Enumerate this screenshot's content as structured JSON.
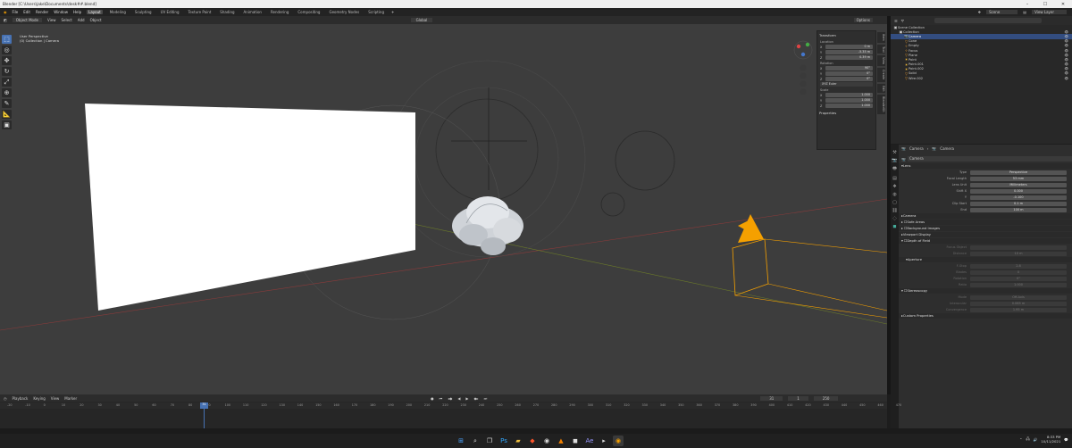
{
  "window": {
    "title": "Blender [C:\\Users\\jake\\Documents\\desk##.blend]"
  },
  "topbar": {
    "menus": [
      "File",
      "Edit",
      "Render",
      "Window",
      "Help"
    ],
    "workspaces": [
      "Layout",
      "Modeling",
      "Sculpting",
      "UV Editing",
      "Texture Paint",
      "Shading",
      "Animation",
      "Rendering",
      "Compositing",
      "Geometry Nodes",
      "Scripting"
    ],
    "scene": "Scene",
    "view_layer": "View Layer"
  },
  "viewport": {
    "mode": "Object Mode",
    "menus": [
      "View",
      "Select",
      "Add",
      "Object"
    ],
    "transform_orientation": "Global",
    "options_label": "Options",
    "info_line1": "User Perspective",
    "info_line2": "(0) Collection | Camera"
  },
  "npanel": {
    "tab_labels": [
      "Item",
      "Tool",
      "View",
      "Create",
      "Edit",
      "BlenderKit"
    ],
    "transform_header": "Transform",
    "location_label": "Location",
    "location": [
      {
        "axis": "X",
        "value": "0 m"
      },
      {
        "axis": "Y",
        "value": "-5.35 m"
      },
      {
        "axis": "Z",
        "value": "0.39 m"
      }
    ],
    "rotation_label": "Rotation",
    "rotation": [
      {
        "axis": "X",
        "value": "90°"
      },
      {
        "axis": "Y",
        "value": "0°"
      },
      {
        "axis": "Z",
        "value": "0°"
      }
    ],
    "rotation_mode": "XYZ Euler",
    "scale_label": "Scale",
    "scale": [
      {
        "axis": "X",
        "value": "1.000"
      },
      {
        "axis": "Y",
        "value": "1.000"
      },
      {
        "axis": "Z",
        "value": "1.000"
      }
    ],
    "properties_header": "Properties"
  },
  "outliner": {
    "search_placeholder": "",
    "root": "Scene Collection",
    "items": [
      {
        "name": "Collection",
        "icon": "collection-icon",
        "indent": 1,
        "selected": false
      },
      {
        "name": "Camera",
        "icon": "camera-icon",
        "indent": 2,
        "selected": true
      },
      {
        "name": "Cone",
        "icon": "mesh-icon",
        "indent": 2,
        "selected": false
      },
      {
        "name": "Empty",
        "icon": "empty-icon",
        "indent": 2,
        "selected": false
      },
      {
        "name": "Focus",
        "icon": "empty-icon",
        "indent": 2,
        "selected": false
      },
      {
        "name": "Plane",
        "icon": "mesh-icon",
        "indent": 2,
        "selected": false
      },
      {
        "name": "Point",
        "icon": "light-icon",
        "indent": 2,
        "selected": false
      },
      {
        "name": "Point.001",
        "icon": "light-icon",
        "indent": 2,
        "selected": false
      },
      {
        "name": "Point.002",
        "icon": "light-icon",
        "indent": 2,
        "selected": false
      },
      {
        "name": "Solid",
        "icon": "mesh-icon",
        "indent": 2,
        "selected": false
      },
      {
        "name": "Wire.002",
        "icon": "mesh-icon",
        "indent": 2,
        "selected": false
      }
    ]
  },
  "properties": {
    "breadcrumb_object": "Camera",
    "breadcrumb_data": "Camera",
    "datablock": "Camera",
    "sections": {
      "lens": "Lens",
      "camera": "Camera",
      "safe_areas": "Safe Areas",
      "background_images": "Background Images",
      "viewport_display": "Viewport Display",
      "depth_of_field": "Depth of Field",
      "aperture": "Aperture",
      "stereoscopy": "Stereoscopy",
      "custom_properties": "Custom Properties"
    },
    "lens": [
      {
        "label": "Type",
        "value": "Perspective"
      },
      {
        "label": "Focal Length",
        "value": "53 mm"
      },
      {
        "label": "Lens Unit",
        "value": "Millimeters"
      },
      {
        "label": "Shift X",
        "value": "0.000"
      },
      {
        "label": "Y",
        "value": "-0.100"
      },
      {
        "label": "Clip Start",
        "value": "0.1 m"
      },
      {
        "label": "End",
        "value": "100 m"
      }
    ],
    "dof": [
      {
        "label": "Focus Object",
        "value": ""
      },
      {
        "label": "Distance",
        "value": "10 m"
      }
    ],
    "aperture": [
      {
        "label": "F-Stop",
        "value": "2.8"
      },
      {
        "label": "Blades",
        "value": "0"
      },
      {
        "label": "Rotation",
        "value": "0°"
      },
      {
        "label": "Ratio",
        "value": "1.000"
      }
    ],
    "stereo": [
      {
        "label": "Mode",
        "value": "Off-Axis"
      },
      {
        "label": "Interocular",
        "value": "0.065 m"
      },
      {
        "label": "Convergence",
        "value": "1.95 m"
      }
    ]
  },
  "timeline": {
    "menus": [
      "Playback",
      "Keying",
      "View",
      "Marker"
    ],
    "current_frame": "31",
    "start": "1",
    "end": "250",
    "ruler": [
      "-20",
      "-10",
      "0",
      "10",
      "20",
      "30",
      "40",
      "50",
      "60",
      "70",
      "80",
      "90",
      "100",
      "110",
      "120",
      "130",
      "140",
      "150",
      "160",
      "170",
      "180",
      "190",
      "200",
      "210",
      "220",
      "230",
      "240",
      "250",
      "260",
      "270",
      "280",
      "290",
      "300",
      "310",
      "320",
      "330",
      "340",
      "350",
      "360",
      "370",
      "380",
      "390",
      "400",
      "410",
      "420",
      "430",
      "440",
      "450",
      "460",
      "470"
    ]
  },
  "taskbar": {
    "time": "8:33 PM",
    "date": "10/11/2021"
  },
  "colors": {
    "accent": "#4772b3",
    "selection": "#334d80",
    "camera_orange": "#f5a000",
    "viewport_bg": "#3d3d3d"
  }
}
